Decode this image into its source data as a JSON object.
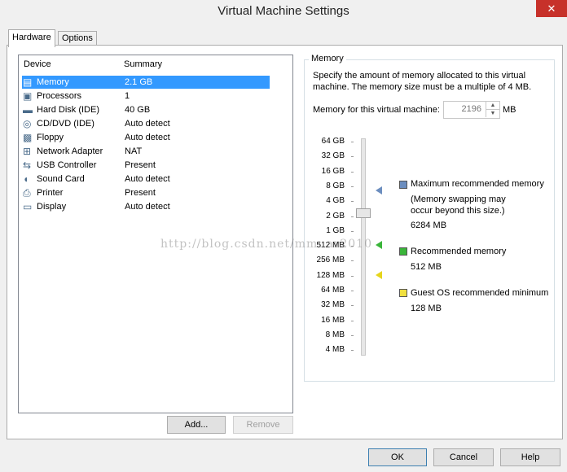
{
  "window": {
    "title": "Virtual Machine Settings",
    "close_glyph": "✕"
  },
  "tabs": [
    "Hardware",
    "Options"
  ],
  "device_list": {
    "headers": {
      "device": "Device",
      "summary": "Summary"
    },
    "items": [
      {
        "name": "Memory",
        "summary": "2.1 GB",
        "icon": "memory-icon",
        "selected": true
      },
      {
        "name": "Processors",
        "summary": "1",
        "icon": "processor-icon"
      },
      {
        "name": "Hard Disk (IDE)",
        "summary": "40 GB",
        "icon": "hard-disk-icon"
      },
      {
        "name": "CD/DVD (IDE)",
        "summary": "Auto detect",
        "icon": "cd-dvd-icon"
      },
      {
        "name": "Floppy",
        "summary": "Auto detect",
        "icon": "floppy-icon"
      },
      {
        "name": "Network Adapter",
        "summary": "NAT",
        "icon": "network-adapter-icon"
      },
      {
        "name": "USB Controller",
        "summary": "Present",
        "icon": "usb-icon"
      },
      {
        "name": "Sound Card",
        "summary": "Auto detect",
        "icon": "sound-card-icon"
      },
      {
        "name": "Printer",
        "summary": "Present",
        "icon": "printer-icon"
      },
      {
        "name": "Display",
        "summary": "Auto detect",
        "icon": "display-icon"
      }
    ]
  },
  "list_buttons": {
    "add": "Add...",
    "remove": "Remove"
  },
  "memory": {
    "group_label": "Memory",
    "description": "Specify the amount of memory allocated to this virtual machine. The memory size must be a multiple of 4 MB.",
    "field_label": "Memory for this virtual machine:",
    "value": "2196",
    "unit": "MB",
    "scale": [
      "64 GB",
      "32 GB",
      "16 GB",
      "8 GB",
      "4 GB",
      "2 GB",
      "1 GB",
      "512 MB",
      "256 MB",
      "128 MB",
      "64 MB",
      "32 MB",
      "16 MB",
      "8 MB",
      "4 MB"
    ],
    "legend": {
      "max_label": "Maximum recommended memory",
      "max_note": "(Memory swapping may occur beyond this size.)",
      "max_value": "6284 MB",
      "rec_label": "Recommended memory",
      "rec_value": "512 MB",
      "min_label": "Guest OS recommended minimum",
      "min_value": "128 MB"
    },
    "colors": {
      "max": "#6c8ebf",
      "rec": "#3ab53a",
      "min": "#f0e040"
    }
  },
  "watermark": "http://blog.csdn.net/mmuar2010",
  "footer_buttons": {
    "ok": "OK",
    "cancel": "Cancel",
    "help": "Help"
  }
}
